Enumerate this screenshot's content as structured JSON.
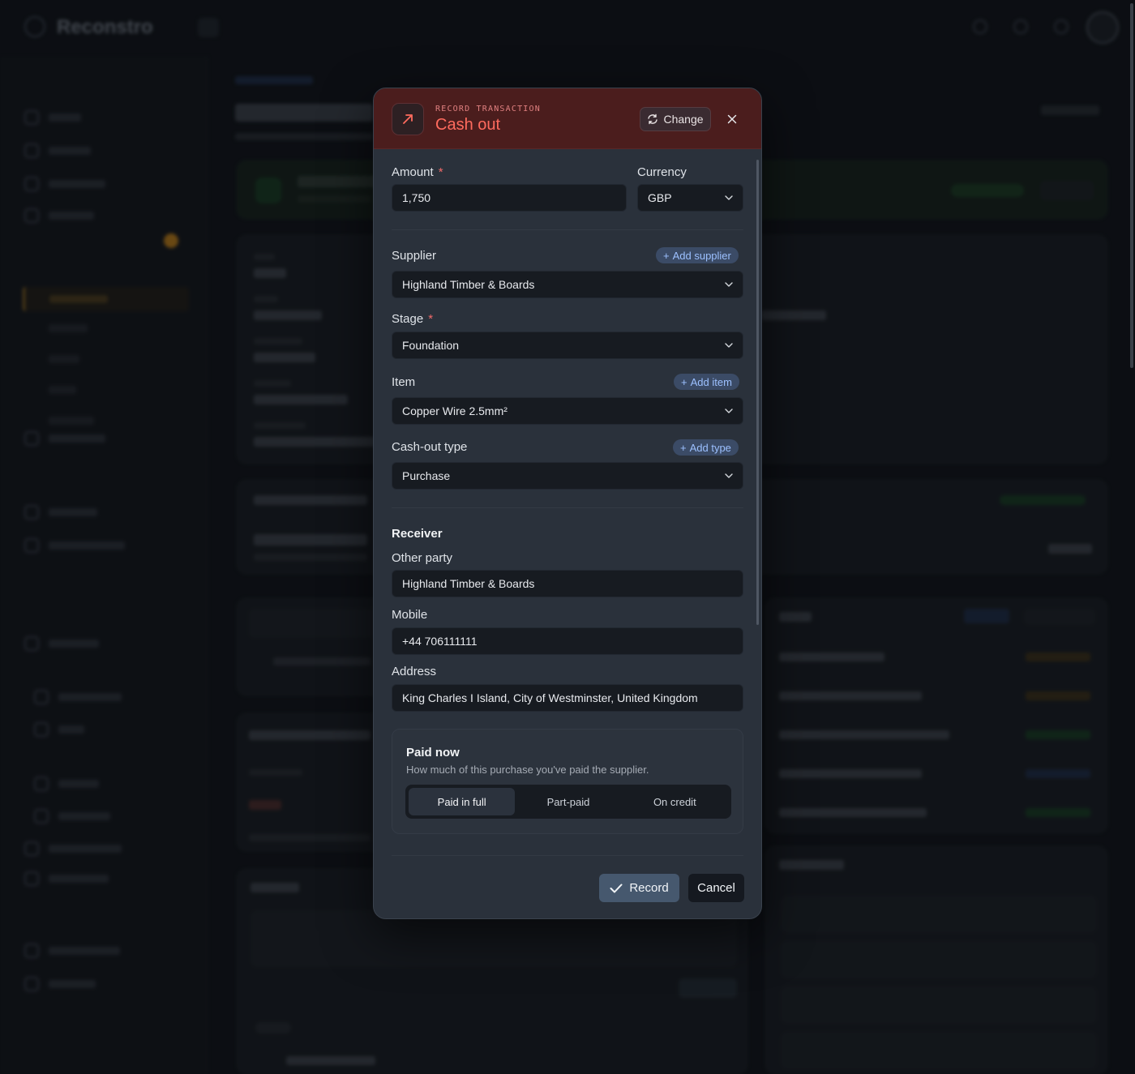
{
  "modal": {
    "eyebrow": "RECORD TRANSACTION",
    "title": "Cash out",
    "change_label": "Change",
    "amount": {
      "label": "Amount",
      "required": "*",
      "value": "1,750"
    },
    "currency": {
      "label": "Currency",
      "value": "GBP"
    },
    "supplier": {
      "label": "Supplier",
      "add_label": "Add supplier",
      "value": "Highland Timber & Boards"
    },
    "stage": {
      "label": "Stage",
      "required": "*",
      "value": "Foundation"
    },
    "item": {
      "label": "Item",
      "add_label": "Add item",
      "value": "Copper Wire 2.5mm²"
    },
    "cashout_type": {
      "label": "Cash-out type",
      "add_label": "Add type",
      "value": "Purchase"
    },
    "receiver": {
      "title": "Receiver",
      "other_party_label": "Other party",
      "other_party_value": "Highland Timber & Boards",
      "mobile_label": "Mobile",
      "mobile_value": "+44 706111111",
      "address_label": "Address",
      "address_value": "King Charles I Island, City of Westminster, United Kingdom"
    },
    "paid_now": {
      "title": "Paid now",
      "subtitle": "How much of this purchase you've paid the supplier.",
      "options": [
        "Paid in full",
        "Part-paid",
        "On credit"
      ],
      "selected": "Paid in full"
    },
    "record_label": "Record",
    "cancel_label": "Cancel"
  },
  "colors": {
    "header_bg": "#4b1d1d",
    "title_accent": "#ff6b5e",
    "add_pill_text": "#9cc0ff",
    "record_bg": "#46586e"
  }
}
